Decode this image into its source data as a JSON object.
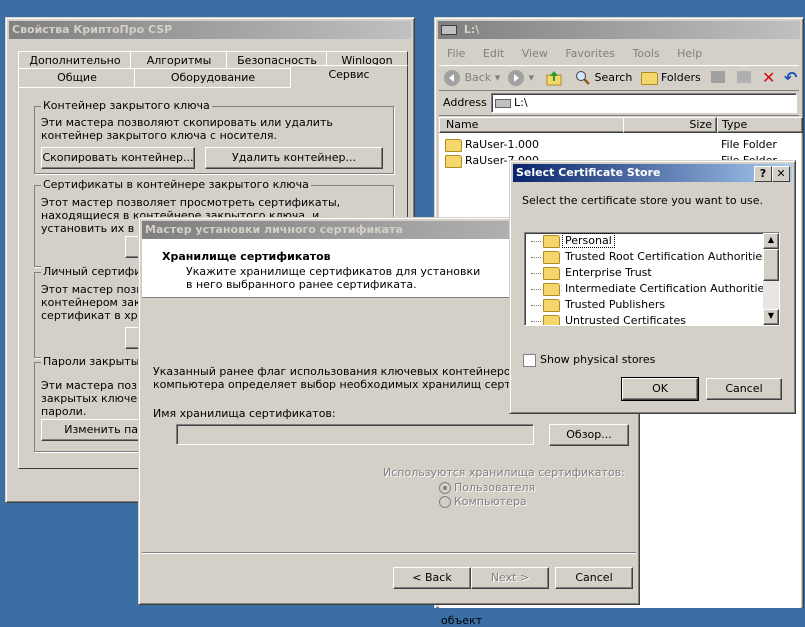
{
  "csp_window": {
    "title": "Свойства КриптоПро CSP",
    "tabs_row1": [
      "Дополнительно",
      "Алгоритмы",
      "Безопасность",
      "Winlogon"
    ],
    "tabs_row2": [
      "Общие",
      "Оборудование",
      "Сервис"
    ],
    "group_container": {
      "label": "Контейнер закрытого ключа",
      "text": "Эти мастера позволяют скопировать или удалить контейнер закрытого ключа с носителя.",
      "copy_button": "Скопировать контейнер...",
      "delete_button": "Удалить контейнер..."
    },
    "group_certs": {
      "label": "Сертификаты в контейнере закрытого ключа",
      "text": "Этот мастер позволяет просмотреть сертификаты, находящиеся в контейнере закрытого ключа, и установить их в хранилище сертификатов."
    },
    "group_personal": {
      "label": "Личный сертификат",
      "text": "Этот мастер позволяет связать сертификат из файла с контейнером закрытого ключа, установив этот сертификат в хранилище."
    },
    "group_passwords": {
      "label": "Пароли закрытых ключей",
      "text": "Эти мастера позволяют изменить пароли (ПИН-коды) закрытых ключей или удалить запомненные ранее пароли.",
      "change_button": "Изменить пароль..."
    }
  },
  "explorer": {
    "title": "L:\\",
    "menu": [
      "File",
      "Edit",
      "View",
      "Favorites",
      "Tools",
      "Help"
    ],
    "toolbar": {
      "back": "Back",
      "search": "Search",
      "folders": "Folders"
    },
    "address_label": "Address",
    "address_value": "L:\\",
    "columns": [
      "Name",
      "Size",
      "Type"
    ],
    "rows": [
      {
        "name": "RaUser-1.000",
        "type": "File Folder"
      },
      {
        "name": "RaUser-7.000",
        "type": "File Folder"
      }
    ],
    "status_fragment": "объект"
  },
  "wizard": {
    "title": "Мастер установки личного сертификата",
    "heading": "Хранилище сертификатов",
    "subheading": "Укажите хранилище сертификатов для установки в него выбранного ранее сертификата.",
    "description": "Указанный ранее флаг использования ключевых контейнеров пользователя или компьютера определяет выбор необходимых хранилищ сертификатов.",
    "store_label": "Имя хранилища сертификатов:",
    "store_value": "",
    "browse_button": "Обзор...",
    "used_stores_label": "Используются хранилища сертификатов:",
    "radio_user": "Пользователя",
    "radio_computer": "Компьютера",
    "back_button": "< Back",
    "next_button": "Next >",
    "cancel_button": "Cancel"
  },
  "select_store": {
    "title": "Select Certificate Store",
    "prompt": "Select the certificate store you want to use.",
    "stores": [
      "Personal",
      "Trusted Root Certification Authorities",
      "Enterprise Trust",
      "Intermediate Certification Authorities",
      "Trusted Publishers",
      "Untrusted Certificates"
    ],
    "selected_store": "Personal",
    "show_physical": "Show physical stores",
    "ok_button": "OK",
    "cancel_button": "Cancel"
  }
}
